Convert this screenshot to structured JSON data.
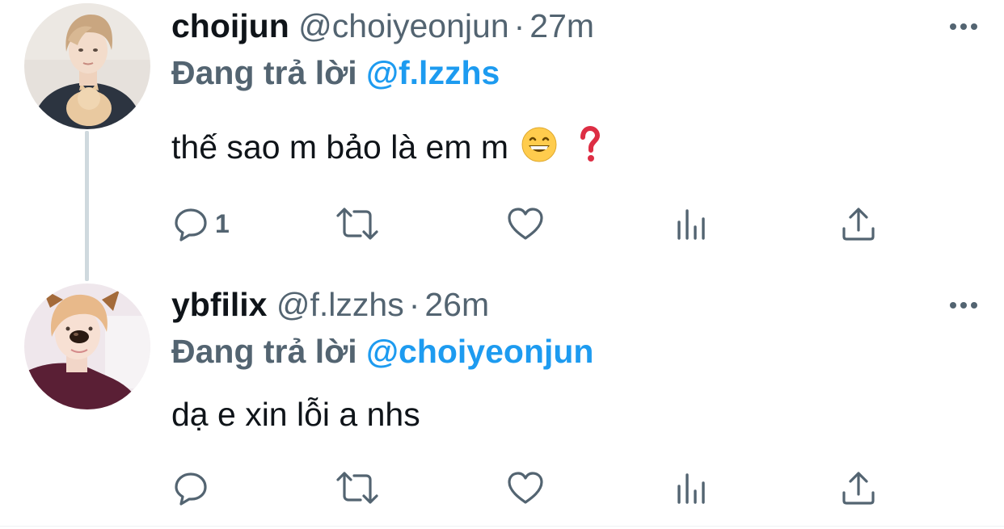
{
  "thread": [
    {
      "display_name": "choijun",
      "handle": "@choiyeonjun",
      "separator": "·",
      "time": "27m",
      "replying_label": "Đang trả lời",
      "replying_to": "@f.lzzhs",
      "text": "thế sao m bảo là em m",
      "emojis": [
        "grinning-face-emoji",
        "red-question-mark-emoji"
      ],
      "reply_count": "1"
    },
    {
      "display_name": "ybfilix",
      "handle": "@f.lzzhs",
      "separator": "·",
      "time": "26m",
      "replying_label": "Đang trả lời",
      "replying_to": "@choiyeonjun",
      "text": "dạ e xin lỗi a nhs",
      "emojis": [],
      "reply_count": ""
    }
  ],
  "icons": {
    "more": "more-dots-icon",
    "reply": "reply-bubble-icon",
    "retweet": "retweet-icon",
    "like": "heart-icon",
    "views": "views-bar-icon",
    "share": "share-icon"
  },
  "colors": {
    "text": "#0f1419",
    "secondary": "#536471",
    "link": "#1d9bf0",
    "thread_line": "#cfd9de"
  }
}
